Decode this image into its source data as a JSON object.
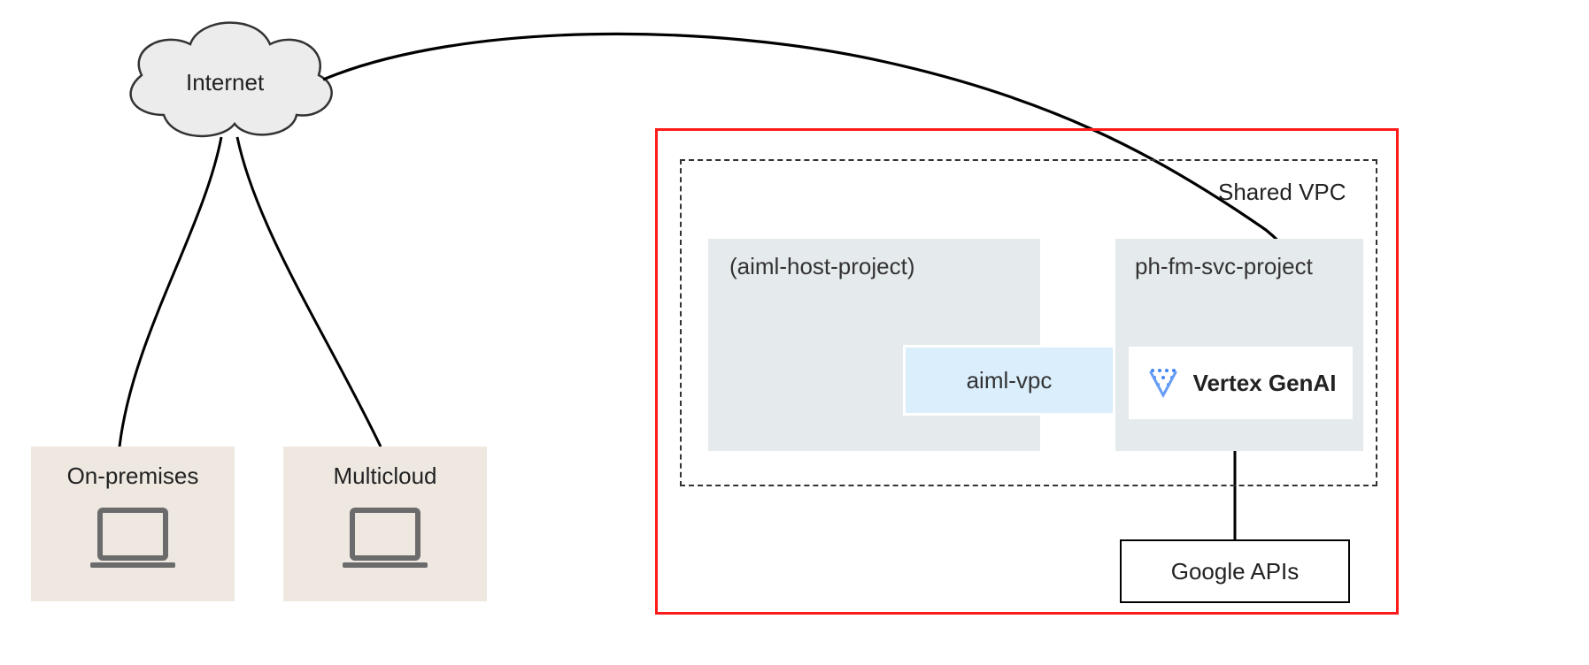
{
  "cloud": {
    "label": "Internet"
  },
  "sources": {
    "onprem": {
      "label": "On-premises"
    },
    "multicloud": {
      "label": "Multicloud"
    }
  },
  "gcp": {
    "shared_vpc_label": "Shared VPC",
    "host_project": {
      "label": "(aiml-host-project)",
      "vpc_label": "aiml-vpc"
    },
    "svc_project": {
      "label": "ph-fm-svc-project",
      "vertex_label": "Vertex GenAI"
    },
    "google_apis_label": "Google APIs"
  }
}
